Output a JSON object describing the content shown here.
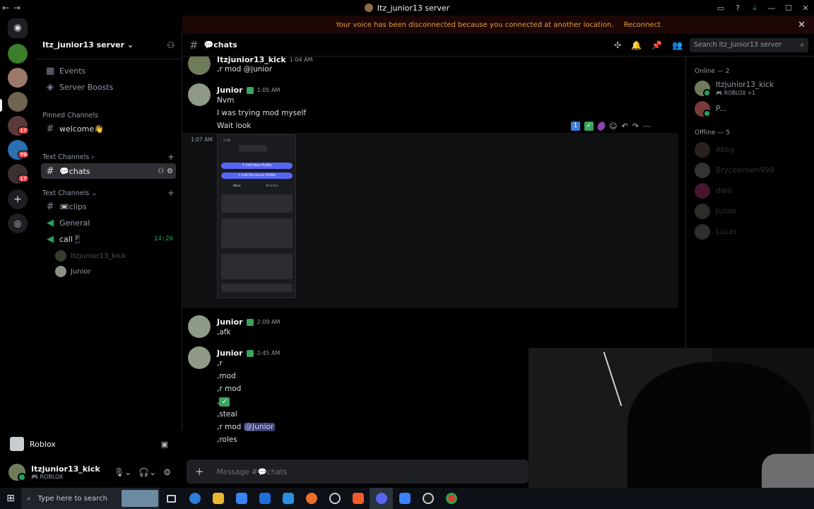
{
  "window": {
    "title": "Itz_junior13 server"
  },
  "notice": {
    "text": "Your voice has been disconnected because you connected at another location.",
    "action": "Reconnect"
  },
  "server_rail": {
    "badges": [
      "17",
      "70",
      "17"
    ]
  },
  "sidebar": {
    "server_name": "Itz_junior13 server",
    "events": "Events",
    "server_boosts": "Server Boosts",
    "pinned_channels_label": "Pinned Channels",
    "welcome": "welcome👋",
    "text_channels_label_1": "Text Channels",
    "chats": "💬chats",
    "text_channels_label_2": "Text Channels",
    "clips": "📼clips",
    "general": "General",
    "call": "call📱",
    "call_timer": "14:26",
    "voice_users": [
      "Itzjunior13_kick",
      "Junior"
    ]
  },
  "activity": {
    "label": "Roblox"
  },
  "user_panel": {
    "name": "Itzjunior13_kick",
    "status": "ROBLOX"
  },
  "channel_header": {
    "name": "💬chats",
    "search_placeholder": "Search Itz_junior13 server"
  },
  "messages": [
    {
      "author": "Itzjunior13_kick",
      "time": "1:04 AM",
      "lines": [
        ",r mod @junior"
      ]
    },
    {
      "author": "Junior",
      "time": "1:05 AM",
      "lines": [
        "Nvm",
        "I was trying mod myself",
        "Wait look"
      ]
    },
    {
      "time": "1:07 AM"
    },
    {
      "author": "Junior",
      "time": "2:09 AM",
      "lines": [
        ",afk"
      ]
    },
    {
      "author": "Junior",
      "time": "2:45 AM",
      "lines": [
        ",r",
        ",mod",
        ",r mod",
        ",",
        ",steal",
        ",r mod ",
        ",roles"
      ],
      "mention": "@Junior"
    }
  ],
  "attachment": {
    "time": "2:06",
    "btn1": "✎ Edit Main Profile",
    "btn2": "✎ Edit Per-server Profile",
    "tab1": "Main",
    "tab2": "Wishlist"
  },
  "composer": {
    "placeholder": "Message #💬chats"
  },
  "members": {
    "online_label": "Online — 2",
    "offline_label": "Offline — 5",
    "online": [
      {
        "name": "Itzjunior13_kick",
        "sub": "ROBLOX +1"
      },
      {
        "name": "P..."
      }
    ],
    "offline": [
      "Abby",
      "Brycebrown999",
      "dani",
      "Junior",
      "Lucas"
    ]
  },
  "taskbar": {
    "search_placeholder": "Type here to search"
  }
}
